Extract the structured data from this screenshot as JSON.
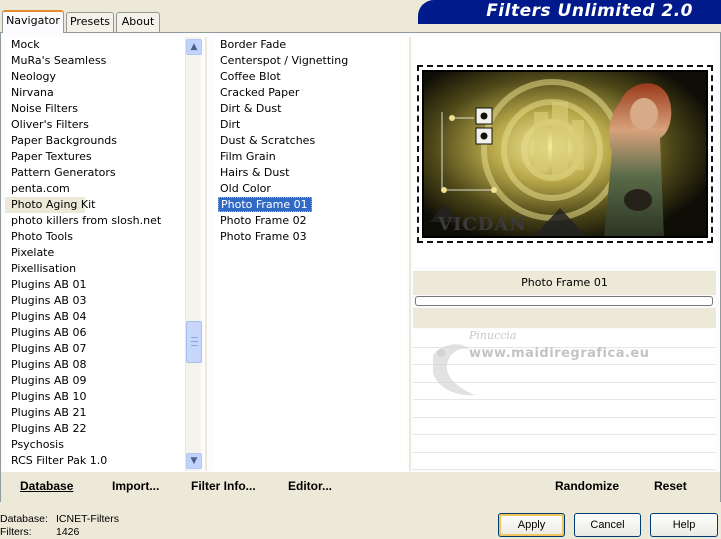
{
  "tabs": [
    "Navigator",
    "Presets",
    "About"
  ],
  "banner_title": "Filters Unlimited 2.0",
  "categories": [
    "Mock",
    "MuRa's Seamless",
    "Neology",
    "Nirvana",
    "Noise Filters",
    "Oliver's Filters",
    "Paper Backgrounds",
    "Paper Textures",
    "Pattern Generators",
    "penta.com",
    "Photo Aging Kit",
    "photo killers from slosh.net",
    "Photo Tools",
    "Pixelate",
    "Pixellisation",
    "Plugins AB 01",
    "Plugins AB 03",
    "Plugins AB 04",
    "Plugins AB 06",
    "Plugins AB 07",
    "Plugins AB 08",
    "Plugins AB 09",
    "Plugins AB 10",
    "Plugins AB 21",
    "Plugins AB 22",
    "Psychosis",
    "RCS Filter Pak 1.0"
  ],
  "selected_category": "Photo Aging Kit",
  "filters": [
    "Border Fade",
    "Centerspot / Vignetting",
    "Coffee Blot",
    "Cracked Paper",
    "Dirt & Dust",
    "Dirt",
    "Dust & Scratches",
    "Film Grain",
    "Hairs & Dust",
    "Old Color",
    "Photo Frame 01",
    "Photo Frame 02",
    "Photo Frame 03"
  ],
  "selected_filter": "Photo Frame 01",
  "preview": {
    "watermark_text": "VICDAN",
    "filter_name": "Photo Frame 01"
  },
  "watermark": {
    "line1": "Pinuccia",
    "line2": "www.maidiregrafica.eu"
  },
  "links": {
    "database": "Database",
    "import": "Import...",
    "filter_info": "Filter Info...",
    "editor": "Editor...",
    "randomize": "Randomize",
    "reset": "Reset"
  },
  "status": {
    "database_label": "Database:",
    "database_value": "ICNET-Filters",
    "filters_label": "Filters:",
    "filters_value": "1426"
  },
  "buttons": {
    "apply": "Apply",
    "cancel": "Cancel",
    "help": "Help"
  },
  "colors": {
    "banner_bg": "#001a8c",
    "selection": "#316ac5",
    "tab_highlight": "#e68b2c"
  }
}
